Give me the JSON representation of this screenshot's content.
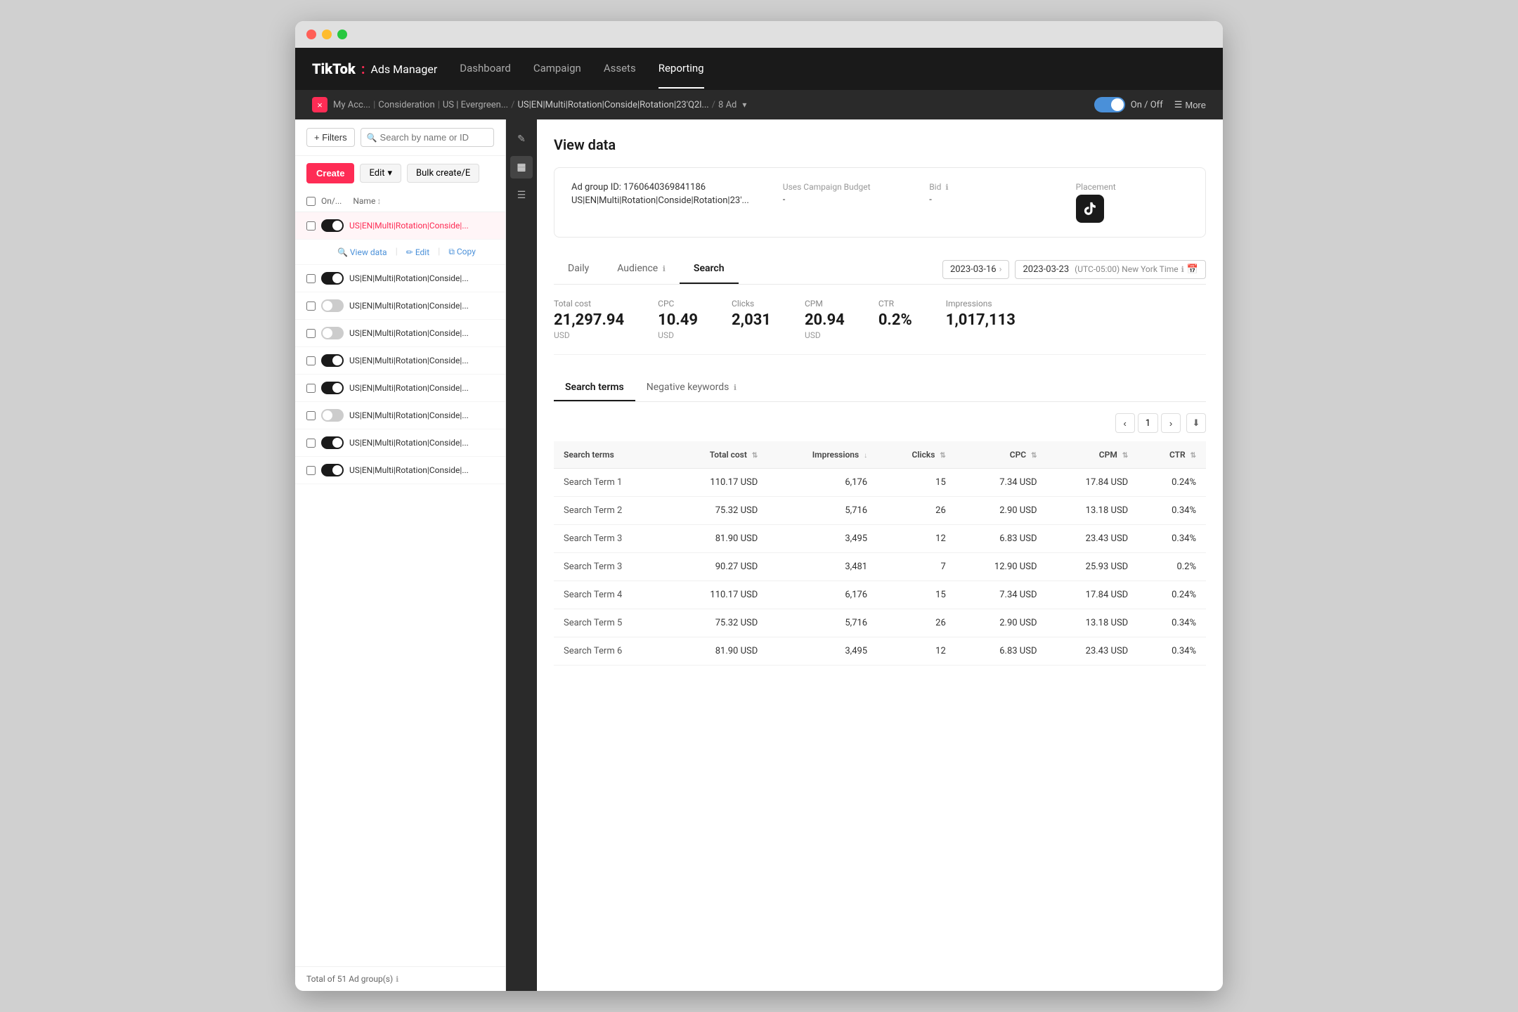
{
  "window": {
    "title": "TikTok Ads Manager"
  },
  "topnav": {
    "logo": "TikTok",
    "logo_dot": ":",
    "logo_sub": "Ads Manager",
    "items": [
      {
        "label": "Dashboard",
        "active": false
      },
      {
        "label": "Campaign",
        "active": false
      },
      {
        "label": "Assets",
        "active": false
      },
      {
        "label": "Reporting",
        "active": true
      }
    ]
  },
  "breadcrumb": {
    "parts": [
      "My Acc...",
      "Consideration",
      "US | Evergreen...",
      "US|EN|Multi|Rotation|Conside|Rotation|23'Q2l...",
      "8 Ad"
    ],
    "close_label": "×",
    "toggle_label": "On / Off",
    "more_label": "More"
  },
  "sidebar": {
    "filter_label": "+ Filters",
    "search_placeholder": "Search by name or ID",
    "nav": {
      "create_label": "Create",
      "edit_label": "Edit",
      "bulk_label": "Bulk create/E"
    },
    "table_header": {
      "on_off": "On/...",
      "name": "Name"
    },
    "rows": [
      {
        "id": 1,
        "name": "US|EN|Multi|Rotation|Conside|...",
        "on": true,
        "active": true,
        "show_actions": true
      },
      {
        "id": 2,
        "name": "US|EN|Multi|Rotation|Conside|...",
        "on": true,
        "active": false,
        "show_actions": false
      },
      {
        "id": 3,
        "name": "US|EN|Multi|Rotation|Conside|...",
        "on": false,
        "active": false,
        "show_actions": false
      },
      {
        "id": 4,
        "name": "US|EN|Multi|Rotation|Conside|...",
        "on": false,
        "active": false,
        "show_actions": false
      },
      {
        "id": 5,
        "name": "US|EN|Multi|Rotation|Conside|...",
        "on": true,
        "active": false,
        "show_actions": false
      },
      {
        "id": 6,
        "name": "US|EN|Multi|Rotation|Conside|...",
        "on": true,
        "active": false,
        "show_actions": false
      },
      {
        "id": 7,
        "name": "US|EN|Multi|Rotation|Conside|...",
        "on": false,
        "active": false,
        "show_actions": false
      },
      {
        "id": 8,
        "name": "US|EN|Multi|Rotation|Conside|...",
        "on": true,
        "active": false,
        "show_actions": false
      },
      {
        "id": 9,
        "name": "US|EN|Multi|Rotation|Conside|...",
        "on": true,
        "active": false,
        "show_actions": false
      }
    ],
    "footer": "Total of 51 Ad group(s)"
  },
  "panel_icons": {
    "pencil": "✎",
    "chart": "▦",
    "list": "☰"
  },
  "content": {
    "title": "View data",
    "ad_group": {
      "id_label": "Ad group ID: 1760640369841186",
      "name": "US|EN|Multi|Rotation|Conside|Rotation|23'...",
      "budget_label": "Uses Campaign Budget",
      "budget_value": "-",
      "bid_label": "Bid",
      "bid_info": "ℹ",
      "bid_value": "-",
      "placement_label": "Placement",
      "placement_icon": "♪"
    },
    "tabs": [
      {
        "label": "Daily",
        "active": false
      },
      {
        "label": "Audience",
        "active": false,
        "info": true
      },
      {
        "label": "Search",
        "active": true
      }
    ],
    "date_range": {
      "start": "2023-03-16",
      "arrow": "›",
      "end": "2023-03-23",
      "timezone": "(UTC-05:00) New York Time",
      "info": "ℹ",
      "calendar_icon": "📅"
    },
    "stats": [
      {
        "label": "Total cost",
        "value": "21,297.94",
        "currency": "USD"
      },
      {
        "label": "CPC",
        "value": "10.49",
        "currency": "USD"
      },
      {
        "label": "Clicks",
        "value": "2,031",
        "currency": ""
      },
      {
        "label": "CPM",
        "value": "20.94",
        "currency": "USD"
      },
      {
        "label": "CTR",
        "value": "0.2%",
        "currency": ""
      },
      {
        "label": "Impressions",
        "value": "1,017,113",
        "currency": ""
      }
    ],
    "subtabs": [
      {
        "label": "Search terms",
        "active": true
      },
      {
        "label": "Negative keywords",
        "active": false,
        "info": true
      }
    ],
    "table": {
      "columns": [
        {
          "key": "term",
          "label": "Search terms",
          "sortable": false
        },
        {
          "key": "cost",
          "label": "Total cost",
          "sortable": true
        },
        {
          "key": "impressions",
          "label": "Impressions",
          "sortable": true
        },
        {
          "key": "clicks",
          "label": "Clicks",
          "sortable": true
        },
        {
          "key": "cpc",
          "label": "CPC",
          "sortable": true
        },
        {
          "key": "cpm",
          "label": "CPM",
          "sortable": true
        },
        {
          "key": "ctr",
          "label": "CTR",
          "sortable": true
        }
      ],
      "rows": [
        {
          "term": "Search Term 1",
          "cost": "110.17 USD",
          "impressions": "6,176",
          "clicks": "15",
          "cpc": "7.34 USD",
          "cpm": "17.84 USD",
          "ctr": "0.24%"
        },
        {
          "term": "Search Term 2",
          "cost": "75.32 USD",
          "impressions": "5,716",
          "clicks": "26",
          "cpc": "2.90 USD",
          "cpm": "13.18 USD",
          "ctr": "0.34%"
        },
        {
          "term": "Search Term 3",
          "cost": "81.90 USD",
          "impressions": "3,495",
          "clicks": "12",
          "cpc": "6.83 USD",
          "cpm": "23.43 USD",
          "ctr": "0.34%"
        },
        {
          "term": "Search Term 3",
          "cost": "90.27 USD",
          "impressions": "3,481",
          "clicks": "7",
          "cpc": "12.90 USD",
          "cpm": "25.93 USD",
          "ctr": "0.2%"
        },
        {
          "term": "Search Term 4",
          "cost": "110.17 USD",
          "impressions": "6,176",
          "clicks": "15",
          "cpc": "7.34 USD",
          "cpm": "17.84 USD",
          "ctr": "0.24%"
        },
        {
          "term": "Search Term 5",
          "cost": "75.32 USD",
          "impressions": "5,716",
          "clicks": "26",
          "cpc": "2.90 USD",
          "cpm": "13.18 USD",
          "ctr": "0.34%"
        },
        {
          "term": "Search Term 6",
          "cost": "81.90 USD",
          "impressions": "3,495",
          "clicks": "12",
          "cpc": "6.83 USD",
          "cpm": "23.43 USD",
          "ctr": "0.34%"
        }
      ],
      "page": "1"
    }
  }
}
